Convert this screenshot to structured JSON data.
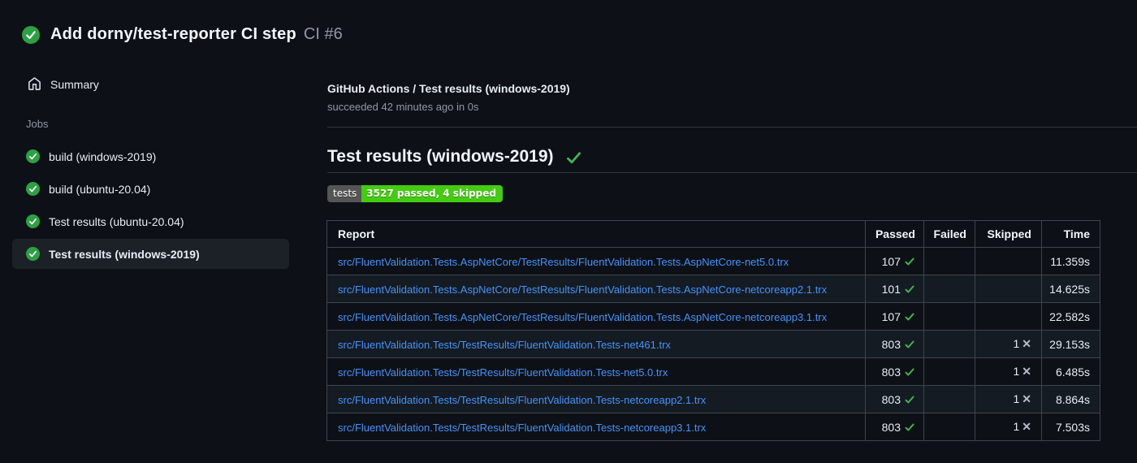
{
  "header": {
    "title": "Add dorny/test-reporter CI step",
    "run_number": "CI #6"
  },
  "sidebar": {
    "summary_label": "Summary",
    "jobs_label": "Jobs",
    "jobs": [
      {
        "label": "build (windows-2019)",
        "selected": false
      },
      {
        "label": "build (ubuntu-20.04)",
        "selected": false
      },
      {
        "label": "Test results (ubuntu-20.04)",
        "selected": false
      },
      {
        "label": "Test results (windows-2019)",
        "selected": true
      }
    ]
  },
  "main": {
    "breadcrumb": "GitHub Actions / Test results (windows-2019)",
    "status_line": "succeeded 42 minutes ago in 0s",
    "heading": "Test results (windows-2019)",
    "badge": {
      "label": "tests",
      "value": "3527 passed, 4 skipped"
    },
    "table": {
      "columns": [
        "Report",
        "Passed",
        "Failed",
        "Skipped",
        "Time"
      ],
      "rows": [
        {
          "report": "src/FluentValidation.Tests.AspNetCore/TestResults/FluentValidation.Tests.AspNetCore-net5.0.trx",
          "passed": "107",
          "failed": "",
          "skipped": "",
          "time": "11.359s"
        },
        {
          "report": "src/FluentValidation.Tests.AspNetCore/TestResults/FluentValidation.Tests.AspNetCore-netcoreapp2.1.trx",
          "passed": "101",
          "failed": "",
          "skipped": "",
          "time": "14.625s"
        },
        {
          "report": "src/FluentValidation.Tests.AspNetCore/TestResults/FluentValidation.Tests.AspNetCore-netcoreapp3.1.trx",
          "passed": "107",
          "failed": "",
          "skipped": "",
          "time": "22.582s"
        },
        {
          "report": "src/FluentValidation.Tests/TestResults/FluentValidation.Tests-net461.trx",
          "passed": "803",
          "failed": "",
          "skipped": "1",
          "time": "29.153s"
        },
        {
          "report": "src/FluentValidation.Tests/TestResults/FluentValidation.Tests-net5.0.trx",
          "passed": "803",
          "failed": "",
          "skipped": "1",
          "time": "6.485s"
        },
        {
          "report": "src/FluentValidation.Tests/TestResults/FluentValidation.Tests-netcoreapp2.1.trx",
          "passed": "803",
          "failed": "",
          "skipped": "1",
          "time": "8.864s"
        },
        {
          "report": "src/FluentValidation.Tests/TestResults/FluentValidation.Tests-netcoreapp3.1.trx",
          "passed": "803",
          "failed": "",
          "skipped": "1",
          "time": "7.503s"
        }
      ]
    }
  },
  "icons": {
    "skipped_x": "✕"
  },
  "colors": {
    "background": "#0d1117",
    "success_circle": "#2ea043",
    "success_check": "#3fb950",
    "link": "#4493f8",
    "badge_label_bg": "#555555",
    "badge_value_bg": "#44cc11",
    "border": "#3d444d",
    "muted_text": "#9198a1"
  }
}
